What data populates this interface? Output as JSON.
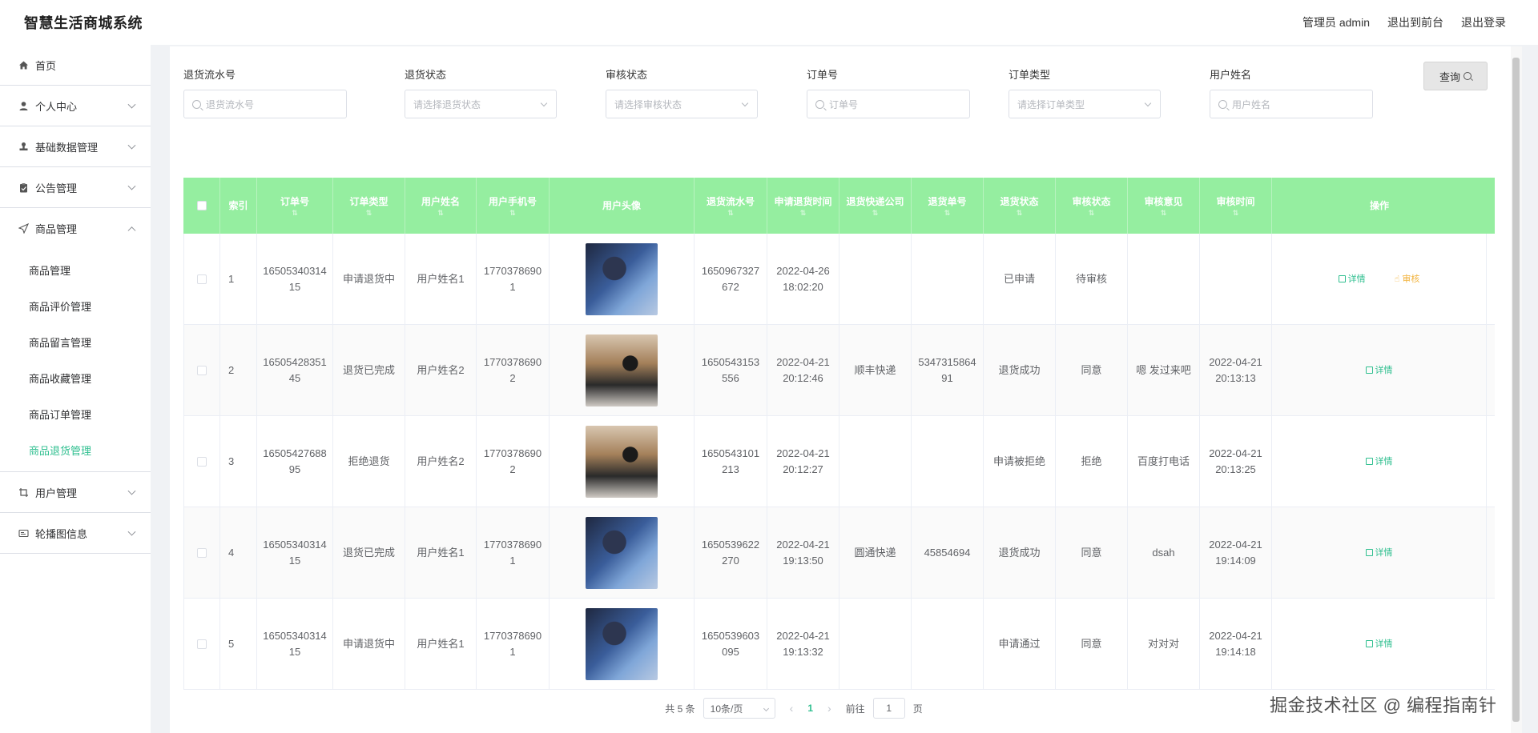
{
  "header": {
    "app_title": "智慧生活商城系统",
    "admin_label": "管理员 admin",
    "back_front": "退出到前台",
    "logout": "退出登录"
  },
  "sidebar": {
    "items": [
      {
        "label": "首页",
        "icon": "home-icon"
      },
      {
        "label": "个人中心",
        "icon": "user-icon"
      },
      {
        "label": "基础数据管理",
        "icon": "stamp-icon"
      },
      {
        "label": "公告管理",
        "icon": "clipboard-icon"
      },
      {
        "label": "商品管理",
        "icon": "send-icon"
      }
    ],
    "sub_items": [
      "商品管理",
      "商品评价管理",
      "商品留言管理",
      "商品收藏管理",
      "商品订单管理",
      "商品退货管理"
    ],
    "after_items": [
      {
        "label": "用户管理",
        "icon": "crop-icon"
      },
      {
        "label": "轮播图信息",
        "icon": "card-icon"
      }
    ]
  },
  "filters": {
    "return_no": {
      "label": "退货流水号",
      "placeholder": "退货流水号"
    },
    "return_status": {
      "label": "退货状态",
      "placeholder": "请选择退货状态"
    },
    "audit_status": {
      "label": "审核状态",
      "placeholder": "请选择审核状态"
    },
    "order_no": {
      "label": "订单号",
      "placeholder": "订单号"
    },
    "order_type": {
      "label": "订单类型",
      "placeholder": "请选择订单类型"
    },
    "user_name": {
      "label": "用户姓名",
      "placeholder": "用户姓名"
    },
    "query_label": "查询"
  },
  "table": {
    "headers": [
      "索引",
      "订单号",
      "订单类型",
      "用户姓名",
      "用户手机号",
      "用户头像",
      "退货流水号",
      "申请退货时间",
      "退货快递公司",
      "退货单号",
      "退货状态",
      "审核状态",
      "审核意见",
      "审核时间",
      "操作"
    ],
    "rows": [
      {
        "idx": "1",
        "order_no": "1650534031415",
        "order_type": "申请退货中",
        "user": "用户姓名1",
        "phone": "17703786901",
        "avatar": "boy",
        "return_no": "1650967327672",
        "apply_time": "2022-04-26 18:02:20",
        "courier": "",
        "ship_no": "",
        "return_status": "已申请",
        "audit_status": "待审核",
        "audit_note": "",
        "audit_time": "",
        "audit_btn": "审核"
      },
      {
        "idx": "2",
        "order_no": "1650542835145",
        "order_type": "退货已完成",
        "user": "用户姓名2",
        "phone": "17703786902",
        "avatar": "man",
        "return_no": "1650543153556",
        "apply_time": "2022-04-21 20:12:46",
        "courier": "顺丰快递",
        "ship_no": "534731586491",
        "return_status": "退货成功",
        "audit_status": "同意",
        "audit_note": "嗯 发过来吧",
        "audit_time": "2022-04-21 20:13:13",
        "audit_btn": ""
      },
      {
        "idx": "3",
        "order_no": "1650542768895",
        "order_type": "拒绝退货",
        "user": "用户姓名2",
        "phone": "17703786902",
        "avatar": "man",
        "return_no": "1650543101213",
        "apply_time": "2022-04-21 20:12:27",
        "courier": "",
        "ship_no": "",
        "return_status": "申请被拒绝",
        "audit_status": "拒绝",
        "audit_note": "百度打电话",
        "audit_time": "2022-04-21 20:13:25",
        "audit_btn": ""
      },
      {
        "idx": "4",
        "order_no": "1650534031415",
        "order_type": "退货已完成",
        "user": "用户姓名1",
        "phone": "17703786901",
        "avatar": "boy",
        "return_no": "1650539622270",
        "apply_time": "2022-04-21 19:13:50",
        "courier": "圆通快递",
        "ship_no": "45854694",
        "return_status": "退货成功",
        "audit_status": "同意",
        "audit_note": "dsah",
        "audit_time": "2022-04-21 19:14:09",
        "audit_btn": ""
      },
      {
        "idx": "5",
        "order_no": "1650534031415",
        "order_type": "申请退货中",
        "user": "用户姓名1",
        "phone": "17703786901",
        "avatar": "boy",
        "return_no": "1650539603095",
        "apply_time": "2022-04-21 19:13:32",
        "courier": "",
        "ship_no": "",
        "return_status": "申请通过",
        "audit_status": "同意",
        "audit_note": "对对对",
        "audit_time": "2022-04-21 19:14:18",
        "audit_btn": ""
      }
    ],
    "detail_label": "详情"
  },
  "pagination": {
    "total": "共 5 条",
    "page_size": "10条/页",
    "current": "1",
    "goto_prefix": "前往",
    "goto_value": "1",
    "goto_suffix": "页"
  },
  "watermark": "掘金技术社区 @ 编程指南针",
  "colors": {
    "header_green": "#95eea0",
    "accent": "#2fbf8f",
    "audit": "#f2b33d"
  }
}
